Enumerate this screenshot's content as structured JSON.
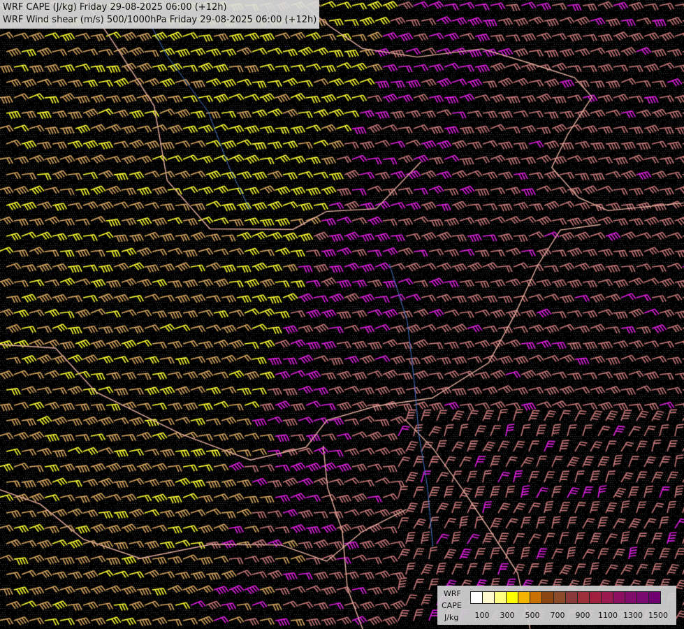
{
  "header": {
    "line1": "WRF CAPE (J/kg) Friday 29-08-2025 06:00 (+12h)",
    "line2": "WRF Wind shear (m/s) 500/1000hPa Friday 29-08-2025 06:00 (+12h)"
  },
  "legend": {
    "model": "WRF",
    "field": "CAPE",
    "unit": "J/kg",
    "colors": [
      "#ffffff",
      "#fffacd",
      "#ffff80",
      "#ffff00",
      "#f4b400",
      "#c87000",
      "#8b4513",
      "#8b4a2a",
      "#8b3a3a",
      "#9c2f3a",
      "#a02040",
      "#9a1a50",
      "#8b1060",
      "#800d6a",
      "#7a0a70",
      "#700070"
    ],
    "tick_labels": [
      "100",
      "300",
      "500",
      "700",
      "900",
      "1100",
      "1300",
      "1500"
    ]
  },
  "map": {
    "background": "#000000",
    "barb_colors": {
      "low_cape": "#ffff33",
      "mid_cape": "#d9a860",
      "high_cape": "#c8787a",
      "very_high_cape": "#e020e0"
    },
    "border_color": "#e8b0a0",
    "river_color": "#4477cc"
  }
}
